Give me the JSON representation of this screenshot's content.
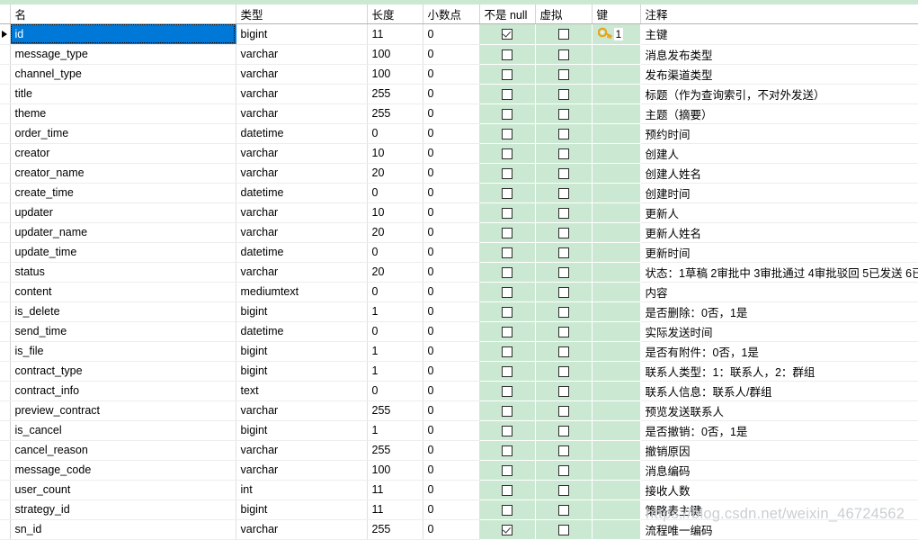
{
  "grid": {
    "headers": {
      "gutter": "",
      "name": "名",
      "type": "类型",
      "length": "长度",
      "decimals": "小数点",
      "not_null": "不是 null",
      "virtual": "虚拟",
      "key": "键",
      "comment": "注释"
    },
    "selected_row_index": 0,
    "rows": [
      {
        "name": "id",
        "type": "bigint",
        "length": "11",
        "decimals": "0",
        "not_null": true,
        "virtual": false,
        "key": "1",
        "comment": "主键"
      },
      {
        "name": "message_type",
        "type": "varchar",
        "length": "100",
        "decimals": "0",
        "not_null": false,
        "virtual": false,
        "key": "",
        "comment": "消息发布类型"
      },
      {
        "name": "channel_type",
        "type": "varchar",
        "length": "100",
        "decimals": "0",
        "not_null": false,
        "virtual": false,
        "key": "",
        "comment": "发布渠道类型"
      },
      {
        "name": "title",
        "type": "varchar",
        "length": "255",
        "decimals": "0",
        "not_null": false,
        "virtual": false,
        "key": "",
        "comment": "标题（作为查询索引，不对外发送）"
      },
      {
        "name": "theme",
        "type": "varchar",
        "length": "255",
        "decimals": "0",
        "not_null": false,
        "virtual": false,
        "key": "",
        "comment": "主题（摘要）"
      },
      {
        "name": "order_time",
        "type": "datetime",
        "length": "0",
        "decimals": "0",
        "not_null": false,
        "virtual": false,
        "key": "",
        "comment": "预约时间"
      },
      {
        "name": "creator",
        "type": "varchar",
        "length": "10",
        "decimals": "0",
        "not_null": false,
        "virtual": false,
        "key": "",
        "comment": "创建人"
      },
      {
        "name": "creator_name",
        "type": "varchar",
        "length": "20",
        "decimals": "0",
        "not_null": false,
        "virtual": false,
        "key": "",
        "comment": "创建人姓名"
      },
      {
        "name": "create_time",
        "type": "datetime",
        "length": "0",
        "decimals": "0",
        "not_null": false,
        "virtual": false,
        "key": "",
        "comment": "创建时间"
      },
      {
        "name": "updater",
        "type": "varchar",
        "length": "10",
        "decimals": "0",
        "not_null": false,
        "virtual": false,
        "key": "",
        "comment": "更新人"
      },
      {
        "name": "updater_name",
        "type": "varchar",
        "length": "20",
        "decimals": "0",
        "not_null": false,
        "virtual": false,
        "key": "",
        "comment": "更新人姓名"
      },
      {
        "name": "update_time",
        "type": "datetime",
        "length": "0",
        "decimals": "0",
        "not_null": false,
        "virtual": false,
        "key": "",
        "comment": "更新时间"
      },
      {
        "name": "status",
        "type": "varchar",
        "length": "20",
        "decimals": "0",
        "not_null": false,
        "virtual": false,
        "key": "",
        "comment": "状态：1草稿 2审批中 3审批通过 4审批驳回 5已发送 6已"
      },
      {
        "name": "content",
        "type": "mediumtext",
        "length": "0",
        "decimals": "0",
        "not_null": false,
        "virtual": false,
        "key": "",
        "comment": "内容"
      },
      {
        "name": "is_delete",
        "type": "bigint",
        "length": "1",
        "decimals": "0",
        "not_null": false,
        "virtual": false,
        "key": "",
        "comment": "是否删除：0否，1是"
      },
      {
        "name": "send_time",
        "type": "datetime",
        "length": "0",
        "decimals": "0",
        "not_null": false,
        "virtual": false,
        "key": "",
        "comment": "实际发送时间"
      },
      {
        "name": "is_file",
        "type": "bigint",
        "length": "1",
        "decimals": "0",
        "not_null": false,
        "virtual": false,
        "key": "",
        "comment": "是否有附件：0否，1是"
      },
      {
        "name": "contract_type",
        "type": "bigint",
        "length": "1",
        "decimals": "0",
        "not_null": false,
        "virtual": false,
        "key": "",
        "comment": "联系人类型：1：联系人，2：群组"
      },
      {
        "name": "contract_info",
        "type": "text",
        "length": "0",
        "decimals": "0",
        "not_null": false,
        "virtual": false,
        "key": "",
        "comment": "联系人信息：联系人/群组"
      },
      {
        "name": "preview_contract",
        "type": "varchar",
        "length": "255",
        "decimals": "0",
        "not_null": false,
        "virtual": false,
        "key": "",
        "comment": "预览发送联系人"
      },
      {
        "name": "is_cancel",
        "type": "bigint",
        "length": "1",
        "decimals": "0",
        "not_null": false,
        "virtual": false,
        "key": "",
        "comment": "是否撤销：0否，1是"
      },
      {
        "name": "cancel_reason",
        "type": "varchar",
        "length": "255",
        "decimals": "0",
        "not_null": false,
        "virtual": false,
        "key": "",
        "comment": "撤销原因"
      },
      {
        "name": "message_code",
        "type": "varchar",
        "length": "100",
        "decimals": "0",
        "not_null": false,
        "virtual": false,
        "key": "",
        "comment": "消息编码"
      },
      {
        "name": "user_count",
        "type": "int",
        "length": "11",
        "decimals": "0",
        "not_null": false,
        "virtual": false,
        "key": "",
        "comment": "接收人数"
      },
      {
        "name": "strategy_id",
        "type": "bigint",
        "length": "11",
        "decimals": "0",
        "not_null": false,
        "virtual": false,
        "key": "",
        "comment": "策略表主键"
      },
      {
        "name": "sn_id",
        "type": "varchar",
        "length": "255",
        "decimals": "0",
        "not_null": true,
        "virtual": false,
        "key": "",
        "comment": "流程唯一编码"
      }
    ]
  },
  "watermark": {
    "text": "https://blog.csdn.net/weixin_46724562"
  },
  "colors": {
    "header_strip": "#cbe8d2",
    "checkbox_column_bg": "#cbe8d2",
    "selection": "#0078d7",
    "key_icon": "#e8a317",
    "watermark": "#c9cfd4"
  }
}
